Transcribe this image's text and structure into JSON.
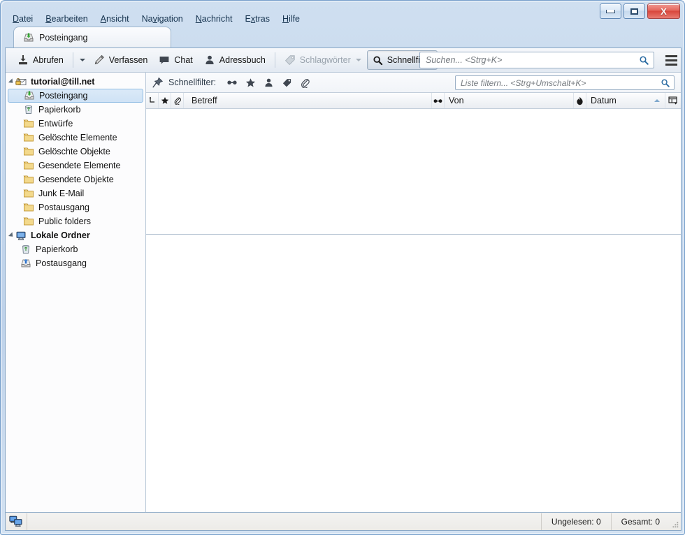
{
  "window": {
    "caption_buttons": [
      {
        "name": "minimize",
        "label": "Minimieren"
      },
      {
        "name": "maximize",
        "label": "Maximieren"
      },
      {
        "name": "close",
        "label": "X"
      }
    ]
  },
  "menubar": {
    "items": [
      {
        "label": "Datei",
        "accel": "D"
      },
      {
        "label": "Bearbeiten",
        "accel": "B"
      },
      {
        "label": "Ansicht",
        "accel": "A"
      },
      {
        "label": "Navigation",
        "accel": "v"
      },
      {
        "label": "Nachricht",
        "accel": "N"
      },
      {
        "label": "Extras",
        "accel": "x"
      },
      {
        "label": "Hilfe",
        "accel": "H"
      }
    ]
  },
  "tabs": [
    {
      "label": "Posteingang",
      "icon": "inbox-icon",
      "active": true
    }
  ],
  "toolbar": {
    "get_messages_label": "Abrufen",
    "write_label": "Verfassen",
    "chat_label": "Chat",
    "addressbook_label": "Adressbuch",
    "tag_label": "Schlagwörter",
    "quickfilter_label": "Schnellfilter",
    "search_placeholder": "Suchen... <Strg+K>"
  },
  "quickfilter": {
    "label": "Schnellfilter:",
    "buttons": [
      {
        "name": "unread-filter",
        "icon": "glasses-icon"
      },
      {
        "name": "starred-filter",
        "icon": "star-icon"
      },
      {
        "name": "contact-filter",
        "icon": "person-icon"
      },
      {
        "name": "tag-filter",
        "icon": "tag-icon"
      },
      {
        "name": "attachment-filter",
        "icon": "paperclip-icon"
      }
    ],
    "filter_placeholder": "Liste filtern... <Strg+Umschalt+K>"
  },
  "columns": {
    "thread_icon": "thread-icon",
    "star_icon": "star-icon",
    "attachment_icon": "paperclip-icon",
    "subject": "Betreff",
    "read_icon": "glasses-icon",
    "from": "Von",
    "junk_icon": "flame-icon",
    "date": "Datum",
    "sort_direction": "asc",
    "picker_icon": "column-picker-icon"
  },
  "folder_pane": {
    "accounts": [
      {
        "name": "tutorial@till.net",
        "icon": "secure-mail-icon",
        "expanded": true,
        "folders": [
          {
            "label": "Posteingang",
            "icon": "inbox-icon",
            "selected": true
          },
          {
            "label": "Papierkorb",
            "icon": "trash-icon",
            "selected": false
          },
          {
            "label": "Entwürfe",
            "icon": "folder-icon",
            "selected": false
          },
          {
            "label": "Gelöschte Elemente",
            "icon": "folder-icon",
            "selected": false
          },
          {
            "label": "Gelöschte Objekte",
            "icon": "folder-icon",
            "selected": false
          },
          {
            "label": "Gesendete Elemente",
            "icon": "folder-icon",
            "selected": false
          },
          {
            "label": "Gesendete Objekte",
            "icon": "folder-icon",
            "selected": false
          },
          {
            "label": "Junk E-Mail",
            "icon": "folder-icon",
            "selected": false
          },
          {
            "label": "Postausgang",
            "icon": "folder-icon",
            "selected": false
          },
          {
            "label": "Public folders",
            "icon": "folder-icon",
            "selected": false
          }
        ]
      },
      {
        "name": "Lokale Ordner",
        "icon": "local-folders-icon",
        "expanded": true,
        "folders": [
          {
            "label": "Papierkorb",
            "icon": "trash-icon",
            "selected": false
          },
          {
            "label": "Postausgang",
            "icon": "outbox-icon",
            "selected": false
          }
        ]
      }
    ]
  },
  "message_list": {
    "rows": []
  },
  "statusbar": {
    "network_icon": "network-icon",
    "unread": "Ungelesen: 0",
    "total": "Gesamt: 0"
  },
  "colors": {
    "accent": "#7fa8cd",
    "selection": "#cfe2f5",
    "frame": "#c3d6ec",
    "close_button": "#d8463c"
  }
}
